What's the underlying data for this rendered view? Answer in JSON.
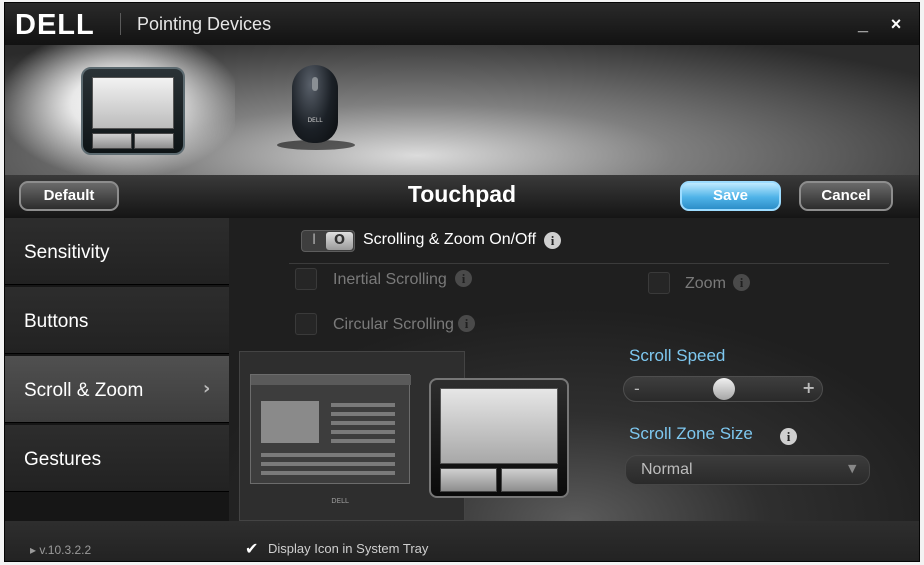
{
  "window": {
    "brand": "DELL",
    "title": "Pointing Devices",
    "minimize": "_",
    "close": "×"
  },
  "devices": [
    {
      "name": "touchpad",
      "icon": "touchpad-icon",
      "selected": true
    },
    {
      "name": "mouse",
      "icon": "mouse-icon",
      "brand": "DELL",
      "selected": false
    }
  ],
  "toolbar": {
    "default_label": "Default",
    "panel_title": "Touchpad",
    "save_label": "Save",
    "cancel_label": "Cancel",
    "save_color": "#4fb3e8"
  },
  "sidebar": {
    "items": [
      {
        "label": "Sensitivity",
        "active": false
      },
      {
        "label": "Buttons",
        "active": false
      },
      {
        "label": "Scroll & Zoom",
        "active": true
      },
      {
        "label": "Gestures",
        "active": false
      }
    ],
    "chevron": "›"
  },
  "scroll_zoom": {
    "toggle": {
      "on_mark": "I",
      "off_mark": "O",
      "label": "Scrolling & Zoom On/Off"
    },
    "options": {
      "inertial": "Inertial Scrolling",
      "zoom": "Zoom",
      "circular": "Circular Scrolling"
    },
    "illustration_brand": "DELL",
    "scroll_speed": {
      "title": "Scroll Speed",
      "minus": "-",
      "plus": "+",
      "level": 0.5
    },
    "zone_size": {
      "title": "Scroll Zone Size",
      "value": "Normal"
    },
    "accent_color": "#7ec8f0"
  },
  "footer": {
    "version": "v.10.3.2.2",
    "tray_label": "Display Icon in System Tray",
    "tray_checked": true
  },
  "info_glyph": "i"
}
